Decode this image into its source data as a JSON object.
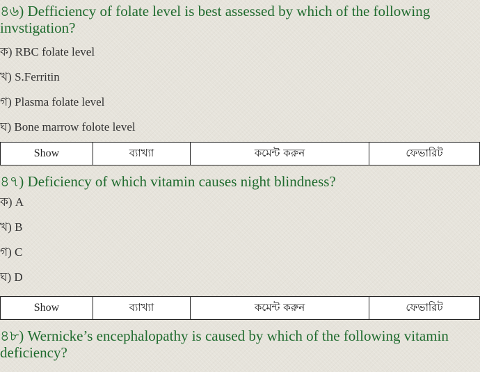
{
  "questions": [
    {
      "title": "৪৬) Defficiency of folate level is best assessed by which of the following invstigation?",
      "options": [
        "ক) RBC folate level",
        "খ) S.Ferritin",
        "গ) Plasma folate level",
        "ঘ) Bone marrow folote level"
      ]
    },
    {
      "title": "৪৭) Deficiency of which vitamin causes night blindness?",
      "options": [
        "ক) A",
        "খ) B",
        "গ) C",
        "ঘ) D"
      ]
    },
    {
      "title": "৪৮) Wernicke’s encephalopathy is caused by which of the following vitamin deficiency?"
    }
  ],
  "action_bar": {
    "show": "Show",
    "explanation": "ব্যাখ্যা",
    "comment": "কমেন্ট করুন",
    "favorite": "ফেভারিট"
  },
  "colors": {
    "question_title": "#1f6b2e",
    "background": "#e6e3db",
    "bar_background": "#ffffff"
  }
}
